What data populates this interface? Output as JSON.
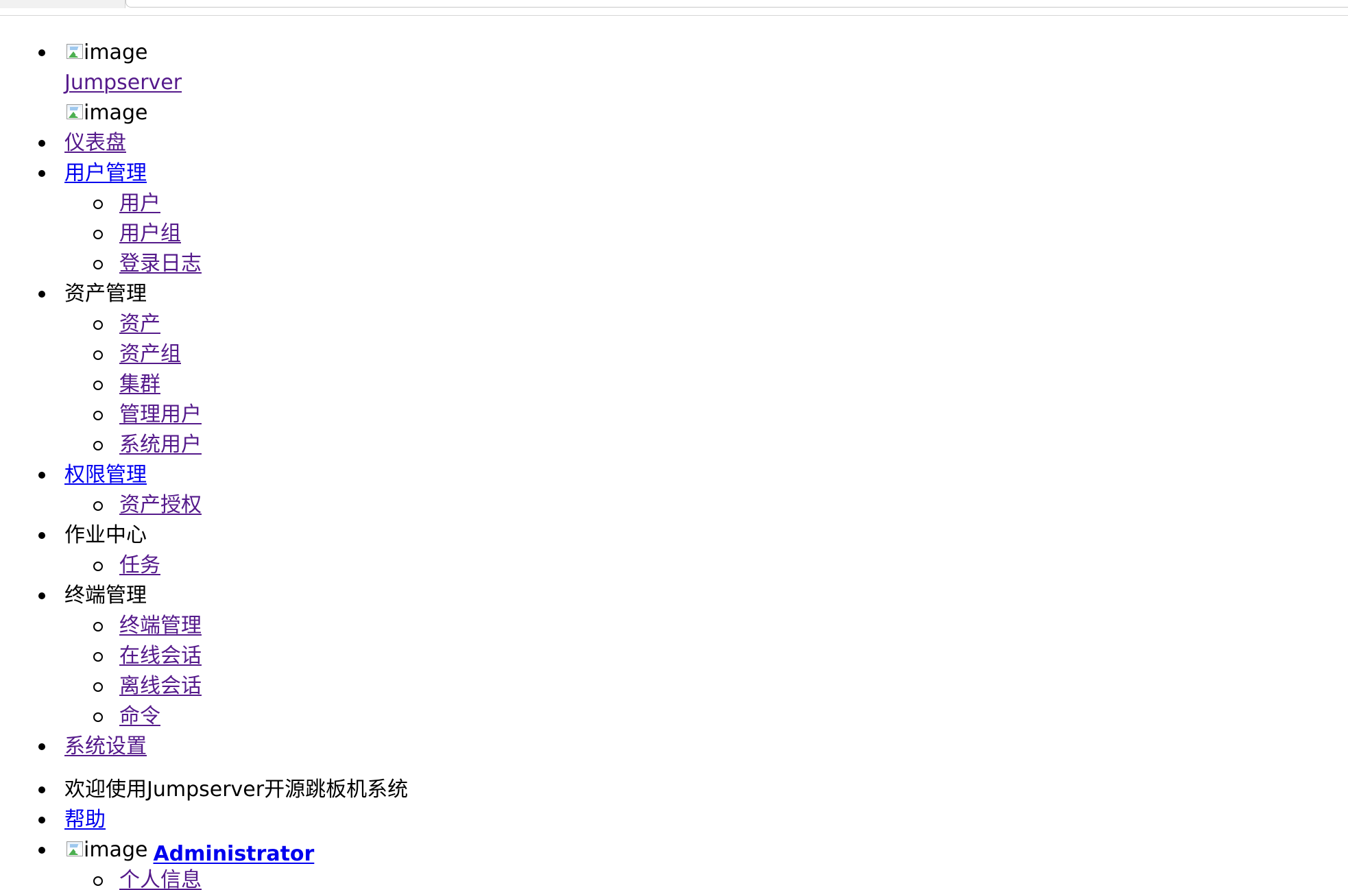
{
  "colors": {
    "link_unvisited": "#0000ee",
    "link_visited": "#551a8b",
    "text": "#000000"
  },
  "icons": {
    "broken_image": "broken-image-icon",
    "bullet_filled": "disc-bullet",
    "bullet_hollow": "circle-bullet"
  },
  "nav": {
    "logo_alt_1": "image",
    "brand_link": "Jumpserver",
    "logo_alt_2": "image",
    "dashboard": "仪表盘",
    "users": {
      "label": "用户管理",
      "items": [
        "用户",
        "用户组",
        "登录日志"
      ]
    },
    "assets": {
      "label": "资产管理",
      "items": [
        "资产",
        "资产组",
        "集群",
        "管理用户",
        "系统用户"
      ]
    },
    "perms": {
      "label": "权限管理",
      "items": [
        "资产授权"
      ]
    },
    "ops": {
      "label": "作业中心",
      "items": [
        "任务"
      ]
    },
    "terminal": {
      "label": "终端管理",
      "items": [
        "终端管理",
        "在线会话",
        "离线会话",
        "命令"
      ]
    },
    "settings": "系统设置"
  },
  "header": {
    "welcome": "欢迎使用Jumpserver开源跳板机系统",
    "help": "帮助",
    "avatar_alt": "image",
    "username": "Administrator",
    "user_menu": [
      "个人信息"
    ]
  }
}
